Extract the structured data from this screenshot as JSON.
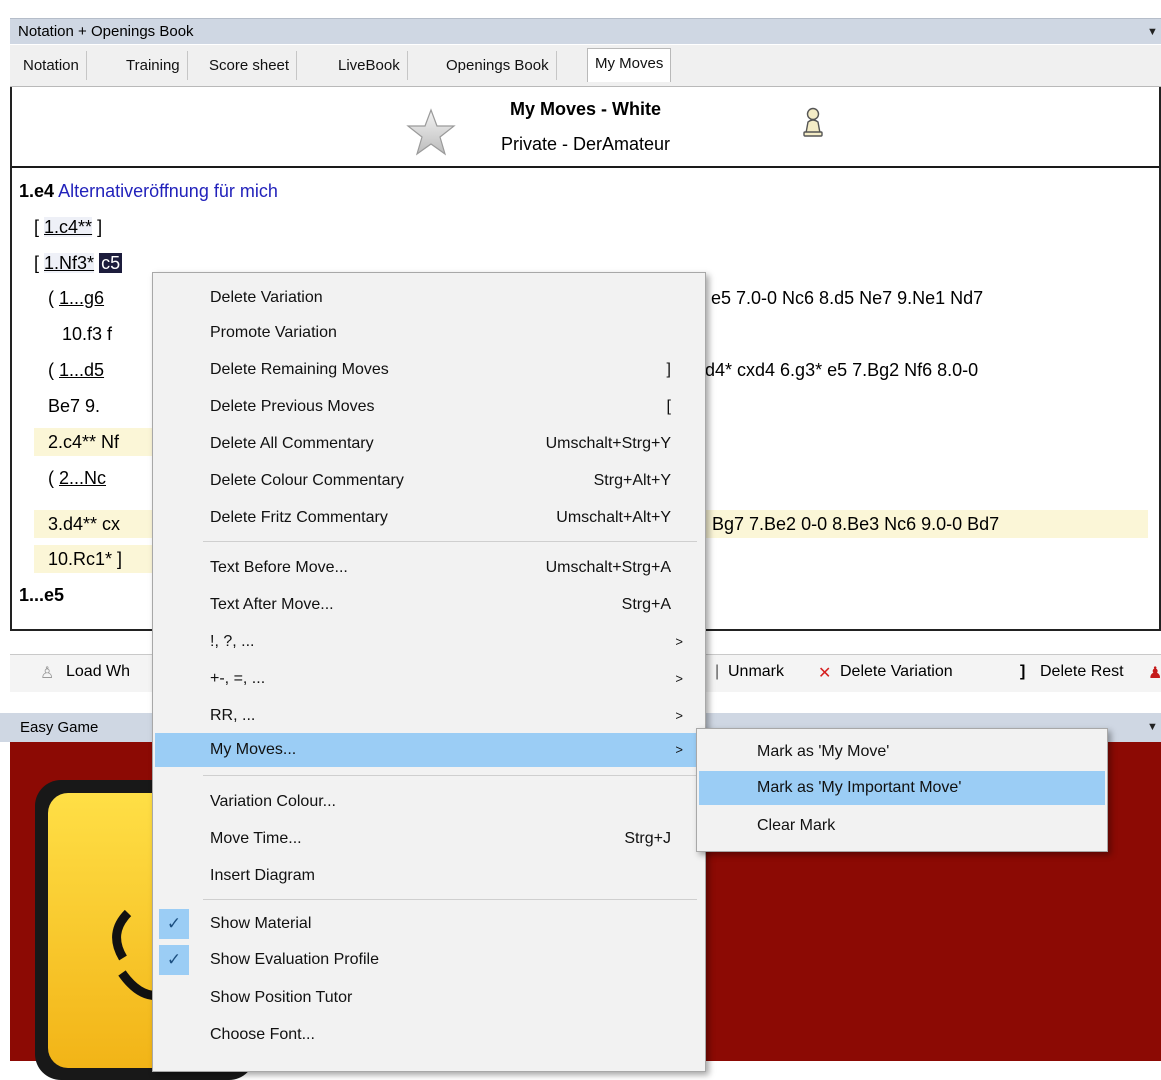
{
  "pane": {
    "title": "Notation + Openings Book"
  },
  "tabs": [
    "Notation",
    "Training",
    "Score sheet",
    "LiveBook",
    "Openings Book",
    "My Moves"
  ],
  "book": {
    "title": "My Moves - White",
    "subtitle": "Private - DerAmateur"
  },
  "notation": {
    "line1_move": "1.e4",
    "line1_comment": "Alternativeröffnung für mich",
    "line2_open": "[",
    "line2_move": "1.c4**",
    "line2_close": "]",
    "line3_open": "[",
    "line3_move": "1.Nf3*",
    "line3_reply": "c5",
    "line4_start": "( ",
    "line4_move": "1...g6",
    "line4_end": "e5 7.0-0  Nc6  8.d5  Ne7  9.Ne1  Nd7",
    "line5_start": "10.f3  f",
    "line6_start": "( ",
    "line6_move": "1...d5",
    "line6_end": "d4*  cxd4  6.g3*  e5  7.Bg2  Nf6  8.0-0",
    "line7_start": "Be7  9.",
    "line8_start": "2.c4**  Nf",
    "line9_start": "( ",
    "line9_move": "2...Nc",
    "line10_start": "3.d4**  cx",
    "line10_end": "Bg7  7.Be2  0-0  8.Be3  Nc6  9.0-0  Bd7",
    "line11_start": "10.Rc1* ]",
    "line12": "1...e5"
  },
  "toolbar": {
    "load": "Load Wh",
    "unmark": "Unmark",
    "delete_variation": "Delete Variation",
    "delete_rest_glyph": "]",
    "delete_rest": "Delete Rest"
  },
  "bottom_pane": {
    "title": "Easy Game"
  },
  "menu": {
    "delete_variation": "Delete Variation",
    "promote_variation": "Promote Variation",
    "delete_remaining": "Delete Remaining Moves",
    "delete_remaining_sc": "]",
    "delete_previous": "Delete Previous Moves",
    "delete_previous_sc": "[",
    "delete_all_comm": "Delete All Commentary",
    "delete_all_comm_sc": "Umschalt+Strg+Y",
    "delete_colour_comm": "Delete Colour Commentary",
    "delete_colour_comm_sc": "Strg+Alt+Y",
    "delete_fritz_comm": "Delete Fritz Commentary",
    "delete_fritz_comm_sc": "Umschalt+Alt+Y",
    "text_before": "Text Before Move...",
    "text_before_sc": "Umschalt+Strg+A",
    "text_after": "Text After Move...",
    "text_after_sc": "Strg+A",
    "annot1": "!, ?, ...",
    "annot2": "+-, =, ...",
    "annot3": "RR, ...",
    "my_moves": "My Moves...",
    "variation_colour": "Variation Colour...",
    "move_time": "Move Time...",
    "move_time_sc": "Strg+J",
    "insert_diagram": "Insert Diagram",
    "show_material": "Show Material",
    "show_eval": "Show Evaluation Profile",
    "show_tutor": "Show Position Tutor",
    "choose_font": "Choose Font..."
  },
  "submenu": {
    "mark_my_move": "Mark as 'My Move'",
    "mark_important": "Mark as 'My Important Move'",
    "clear_mark": "Clear Mark"
  },
  "colors": {
    "highlight": "#9bcdf5",
    "pane_header": "#cfd7e3",
    "easy_game_bg": "#8c0a04"
  }
}
